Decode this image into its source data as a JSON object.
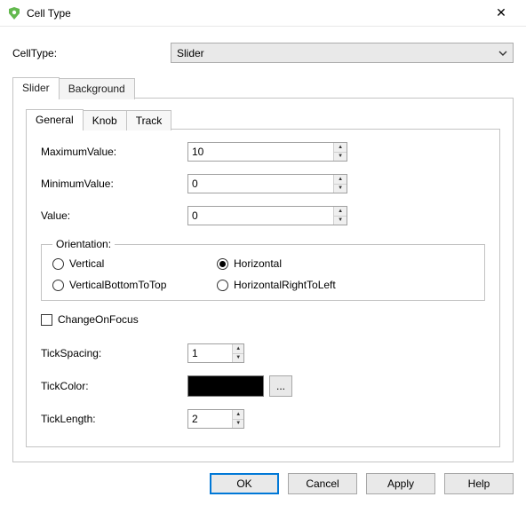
{
  "window": {
    "title": "Cell Type",
    "close_glyph": "✕"
  },
  "icon": {
    "name": "shield-icon",
    "color": "#63b94e"
  },
  "cellType": {
    "label": "CellType:",
    "value": "Slider"
  },
  "outerTabs": [
    {
      "label": "Slider",
      "active": true
    },
    {
      "label": "Background",
      "active": false
    }
  ],
  "innerTabs": [
    {
      "label": "General",
      "active": true
    },
    {
      "label": "Knob",
      "active": false
    },
    {
      "label": "Track",
      "active": false
    }
  ],
  "general": {
    "maxLabel": "MaximumValue:",
    "maxValue": "10",
    "minLabel": "MinimumValue:",
    "minValue": "0",
    "valueLabel": "Value:",
    "value": "0",
    "orientationLegend": "Orientation:",
    "orientation": {
      "vertical": "Vertical",
      "horizontal": "Horizontal",
      "vbt": "VerticalBottomToTop",
      "hrtl": "HorizontalRightToLeft",
      "selected": "horizontal"
    },
    "changeOnFocusLabel": "ChangeOnFocus",
    "changeOnFocusChecked": false,
    "tickSpacingLabel": "TickSpacing:",
    "tickSpacing": "1",
    "tickColorLabel": "TickColor:",
    "tickColor": "#000000",
    "browseLabel": "...",
    "tickLengthLabel": "TickLength:",
    "tickLength": "2"
  },
  "buttons": {
    "ok": "OK",
    "cancel": "Cancel",
    "apply": "Apply",
    "help": "Help"
  }
}
